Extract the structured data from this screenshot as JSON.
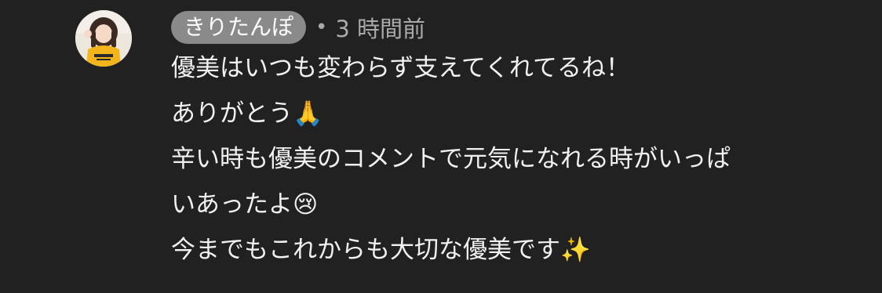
{
  "comment": {
    "author": "きりたんぽ",
    "separator": "•",
    "timestamp": "3 時間前",
    "lines": [
      "優美はいつも変わらず支えてくれてるね！",
      "ありがとう",
      "辛い時も優美のコメントで元気になれる時がいっぱ",
      "いあったよ",
      "今までもこれからも大切な優美です"
    ],
    "emojis": {
      "line2": "🙏",
      "line4": "😢",
      "line5": "✨"
    }
  },
  "colors": {
    "background": "#212121",
    "author_chip": "#8a8a8a",
    "meta_text": "#aaaaaa",
    "body_text": "#f1f1f1"
  },
  "icons": {
    "avatar": "user-avatar-photo"
  }
}
